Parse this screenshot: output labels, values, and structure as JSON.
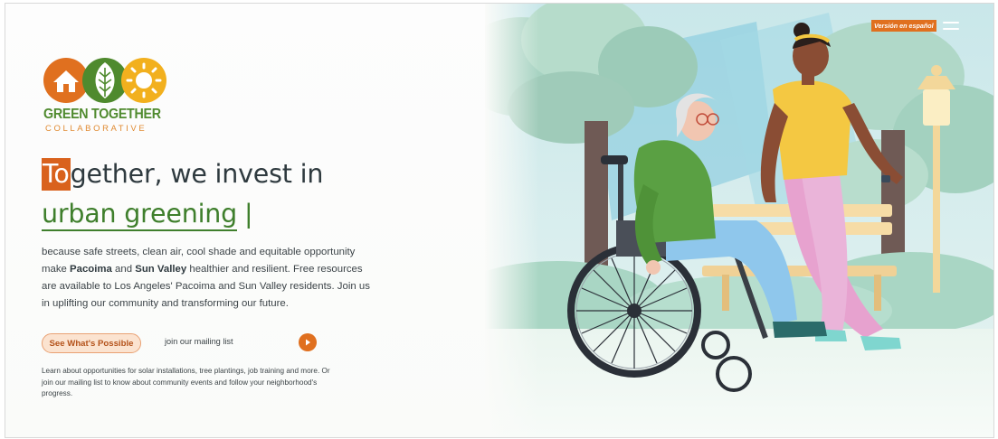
{
  "header": {
    "language_label": "Versión en español",
    "menu_icon": "hamburger-menu-icon"
  },
  "logo": {
    "title": "GREEN TOGETHER",
    "subtitle": "COLLABORATIVE",
    "icons": [
      "house-icon",
      "leaf-icon",
      "sun-icon"
    ],
    "colors": {
      "orange": "#E0701F",
      "green": "#4F8A2E",
      "yellow": "#F2B01E"
    }
  },
  "hero": {
    "headline_cursor": "To",
    "headline_rest": "gether, we invest in",
    "headline_rotating": "urban greening",
    "headline_bar": "|",
    "body_intro": "because safe streets, clean air, cool shade and equitable opportunity make ",
    "body_place1": "Pacoima",
    "body_and": " and ",
    "body_place2": "Sun Valley",
    "body_rest": " healthier and resilient. Free resources are available to Los Angeles' Pacoima and Sun Valley residents. Join us in uplifting our community and transforming our future.",
    "cta_label": "See What's Possible",
    "mailing_label": "join our mailing list",
    "play_icon": "play-icon",
    "sub_text": "Learn about opportunities for solar installations, tree plantings, job training and more. Or join our mailing list to know about community events and follow your neighborhood's progress."
  },
  "colors": {
    "accent_orange": "#E0701F",
    "brand_green": "#3F7F2C",
    "text_dark": "#2F3A3F",
    "cta_bg": "#FBE3D0"
  },
  "illustration": {
    "subject": "woman-in-wheelchair-and-woman-walking-in-park-illustration"
  }
}
